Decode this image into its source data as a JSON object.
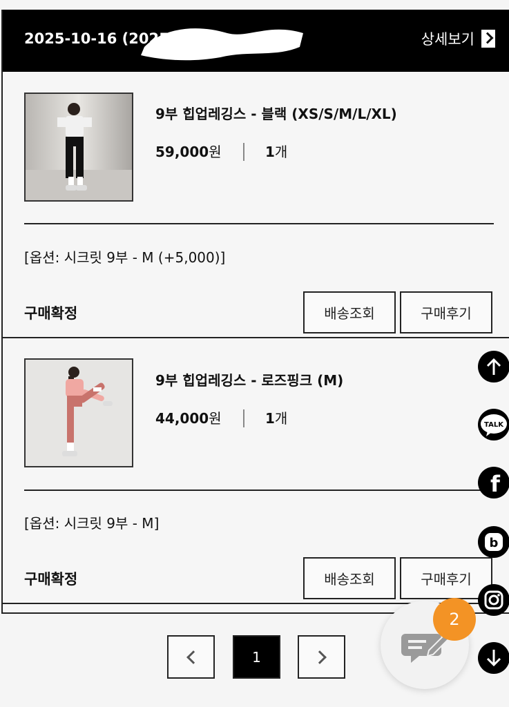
{
  "order": {
    "date": "2025-10-16 (2025",
    "detail_label": "상세보기",
    "status_label": "구매확정",
    "products": [
      {
        "title": "9부 힙업레깅스 - 블랙 (XS/S/M/L/XL)",
        "price": "59,000",
        "price_unit": "원",
        "qty": "1",
        "qty_unit": "개",
        "option": "[옵션: 시크릿 9부 - M (+5,000)]",
        "status": "구매확정",
        "track_button": "배송조회",
        "review_button": "구매후기"
      },
      {
        "title": "9부 힙업레깅스 - 로즈핑크 (M)",
        "price": "44,000",
        "price_unit": "원",
        "qty": "1",
        "qty_unit": "개",
        "option": "[옵션: 시크릿 9부 - M]",
        "status": "구매확정",
        "track_button": "배송조회",
        "review_button": "구매후기"
      }
    ]
  },
  "pagination": {
    "current": "1"
  },
  "floating": {
    "talk_label": "TALK",
    "facebook_label": "f",
    "blog_label": "b",
    "chat_badge": "2"
  }
}
